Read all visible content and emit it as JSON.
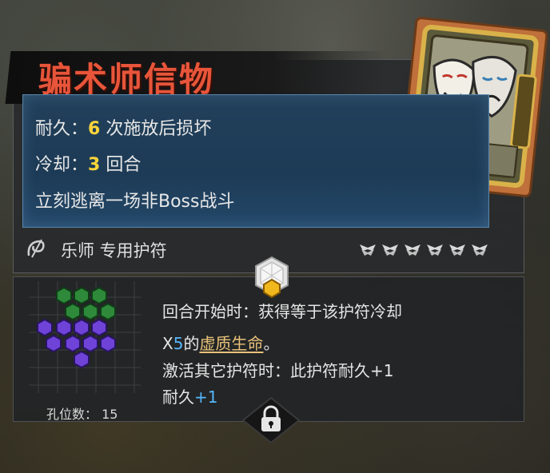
{
  "item": {
    "title": "骗术师信物",
    "durability": {
      "label": "耐久：",
      "value": "6",
      "suffix": "次施放后损坏"
    },
    "cooldown": {
      "label": "冷却：",
      "value": "3",
      "suffix": "回合"
    },
    "effect": "立刻逃离一场非Boss战斗",
    "owner_label": "乐师 专用护符",
    "rarity_icons": 6
  },
  "details": {
    "line1": "回合开始时：获得等于该护符冷却",
    "line2_prefix": "X",
    "line2_num": "5",
    "line2_mid": "的",
    "line2_keyword": "虚质生命",
    "line2_end": "。",
    "line3": "激活其它护符时：此护符耐久+1",
    "line4_prefix": "耐久",
    "line4_num": "+1",
    "holes_label": "孔位数：",
    "holes_value": "15"
  },
  "colors": {
    "title": "#e8553a",
    "highlight_number": "#ffd43a",
    "blue_number": "#55b8ff",
    "keyword": "#e9c27a",
    "green_gem": "#2e8a3a",
    "purple_gem": "#6f43d8"
  },
  "icons": {
    "owner_class": "bard-class-icon",
    "rarity": "winged-rank-icon",
    "badge": "gem-socket-icon",
    "lock": "lock-icon",
    "card": "theatre-masks-card-icon"
  }
}
